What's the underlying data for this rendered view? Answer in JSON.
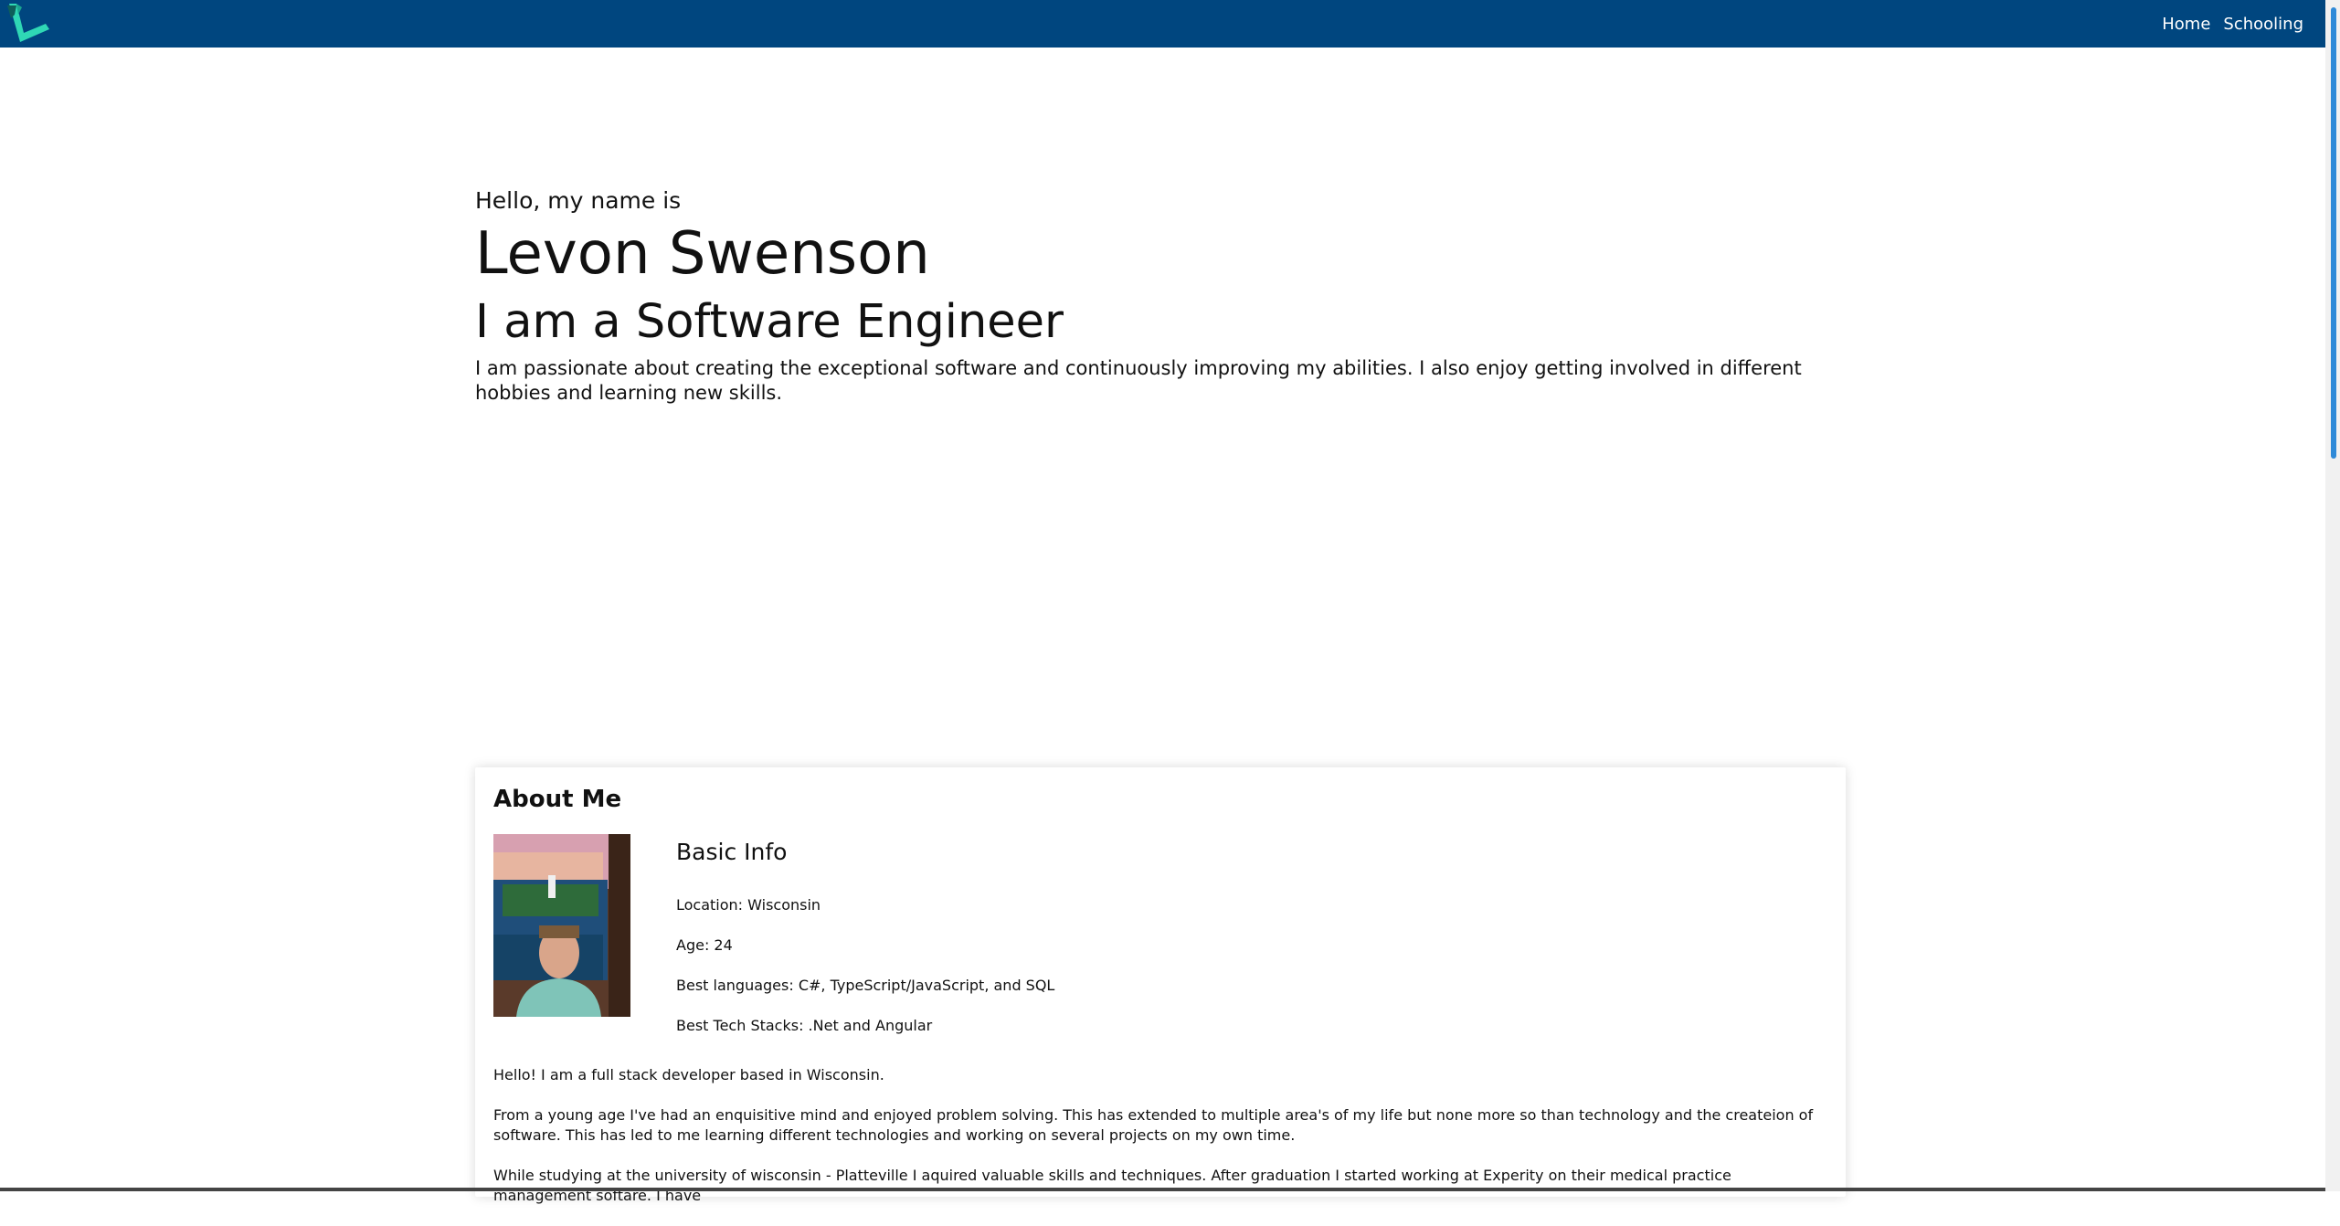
{
  "nav": {
    "logo": "logo",
    "links": [
      "Home",
      "Schooling"
    ]
  },
  "hero": {
    "greeting": "Hello, my name is",
    "name": "Levon Swenson",
    "role": "I am a Software Engineer",
    "intro": "I am passionate about creating the exceptional software and continuously improving my abilities. I also enjoy getting involved in different hobbies and learning new skills."
  },
  "about": {
    "title": "About Me",
    "basic_title": "Basic Info",
    "location": "Location: Wisconsin",
    "age": "Age: 24",
    "languages": "Best languages: C#, TypeScript/JavaScript, and SQL",
    "stacks": "Best Tech Stacks: .Net and Angular",
    "bio": [
      "Hello! I am a full stack developer based in Wisconsin.",
      "From a young age I've had an enquisitive mind and enjoyed problem solving. This has extended to multiple area's of my life but none more so than technology and the createion of software. This has led to me learning different technologies and working on several projects on my own time.",
      "While studying at the university of wisconsin - Platteville I aquired valuable skills and techniques. After graduation I started working at Experity on their medical practice management softare. I have"
    ]
  },
  "colors": {
    "navbar": "#00467f",
    "logo_teal": "#2fd8b5",
    "logo_dark": "#0e5f5a",
    "scroll_thumb": "#2f8ad8"
  }
}
